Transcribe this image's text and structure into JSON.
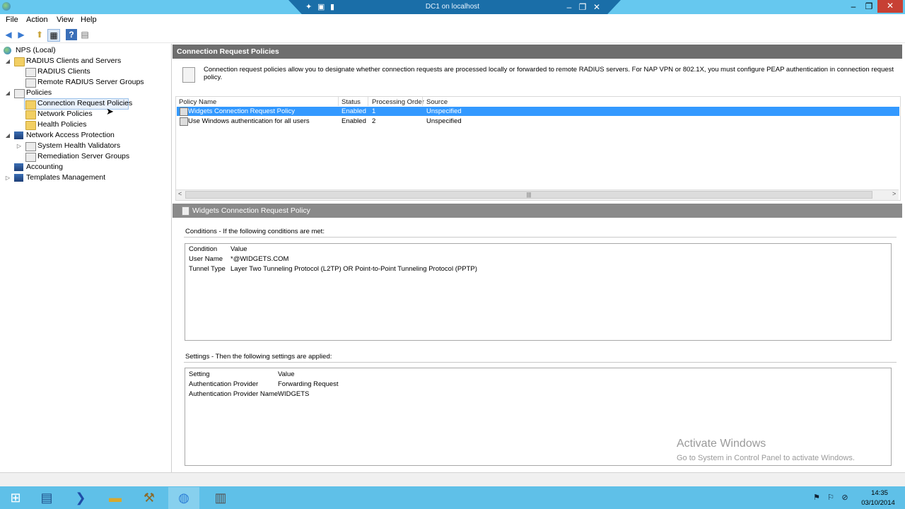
{
  "window": {
    "rdp_title": "DC1 on localhost",
    "minimize_glyph": "–",
    "maximize_glyph": "❐",
    "close_glyph": "✕"
  },
  "menu": [
    "File",
    "Action",
    "View",
    "Help"
  ],
  "toolbar": {
    "icons": [
      "back-icon",
      "forward-icon",
      "up-folder-icon",
      "show-hide-tree-icon",
      "help-icon",
      "properties-icon"
    ],
    "back_glyph": "◀",
    "forward_glyph": "▶",
    "up_glyph": "⬆",
    "tree_glyph": "▦",
    "help_glyph": "?",
    "props_glyph": "▤"
  },
  "tree": {
    "root": "NPS (Local)",
    "radius_clients_servers": "RADIUS Clients and Servers",
    "radius_clients": "RADIUS Clients",
    "remote_radius_groups": "Remote RADIUS Server Groups",
    "policies": "Policies",
    "connection_request_policies": "Connection Request Policies",
    "network_policies": "Network Policies",
    "health_policies": "Health Policies",
    "nap": "Network Access Protection",
    "system_health_validators": "System Health Validators",
    "remediation_server_groups": "Remediation Server Groups",
    "accounting": "Accounting",
    "templates_management": "Templates Management",
    "expanded_glyph": "◢",
    "collapsed_glyph": "▷"
  },
  "main": {
    "header": "Connection Request Policies",
    "description": "Connection request policies allow you to designate whether connection requests are processed locally or forwarded to remote RADIUS servers. For NAP VPN or 802.1X, you must configure PEAP authentication in connection request policy.",
    "columns": [
      "Policy Name",
      "Status",
      "Processing Order",
      "Source"
    ],
    "rows": [
      {
        "name": "Widgets Connection Request Policy",
        "status": "Enabled",
        "order": "1",
        "source": "Unspecified"
      },
      {
        "name": "Use Windows authentication for all users",
        "status": "Enabled",
        "order": "2",
        "source": "Unspecified"
      }
    ],
    "scroll_left": "<",
    "scroll_right": ">",
    "scroll_thumb": "|||"
  },
  "detail": {
    "header": "Widgets Connection Request Policy",
    "conditions_title": "Conditions - If the following conditions are met:",
    "conditions_columns": [
      "Condition",
      "Value"
    ],
    "conditions": [
      {
        "condition": "User Name",
        "value": "*@WIDGETS.COM"
      },
      {
        "condition": "Tunnel Type",
        "value": "Layer Two Tunneling Protocol (L2TP) OR Point-to-Point Tunneling Protocol (PPTP)"
      }
    ],
    "settings_title": "Settings - Then the following settings are applied:",
    "settings_columns": [
      "Setting",
      "Value"
    ],
    "settings": [
      {
        "setting": "Authentication Provider",
        "value": "Forwarding Request"
      },
      {
        "setting": "Authentication Provider Name",
        "value": "WIDGETS"
      }
    ]
  },
  "watermark": {
    "line1": "Activate Windows",
    "line2": "Go to System in Control Panel to activate Windows."
  },
  "taskbar": {
    "apps": [
      "windows-start-icon",
      "server-manager-icon",
      "powershell-icon",
      "file-explorer-icon",
      "tools-icon",
      "nps-globe-icon",
      "notepad-icon"
    ],
    "time": "14:35",
    "date": "03/10/2014"
  },
  "colors": {
    "titlebar": "#66c8ef",
    "selection": "#3399ff",
    "section_header": "#6e6e6e",
    "taskbar": "#5fc0e8"
  }
}
